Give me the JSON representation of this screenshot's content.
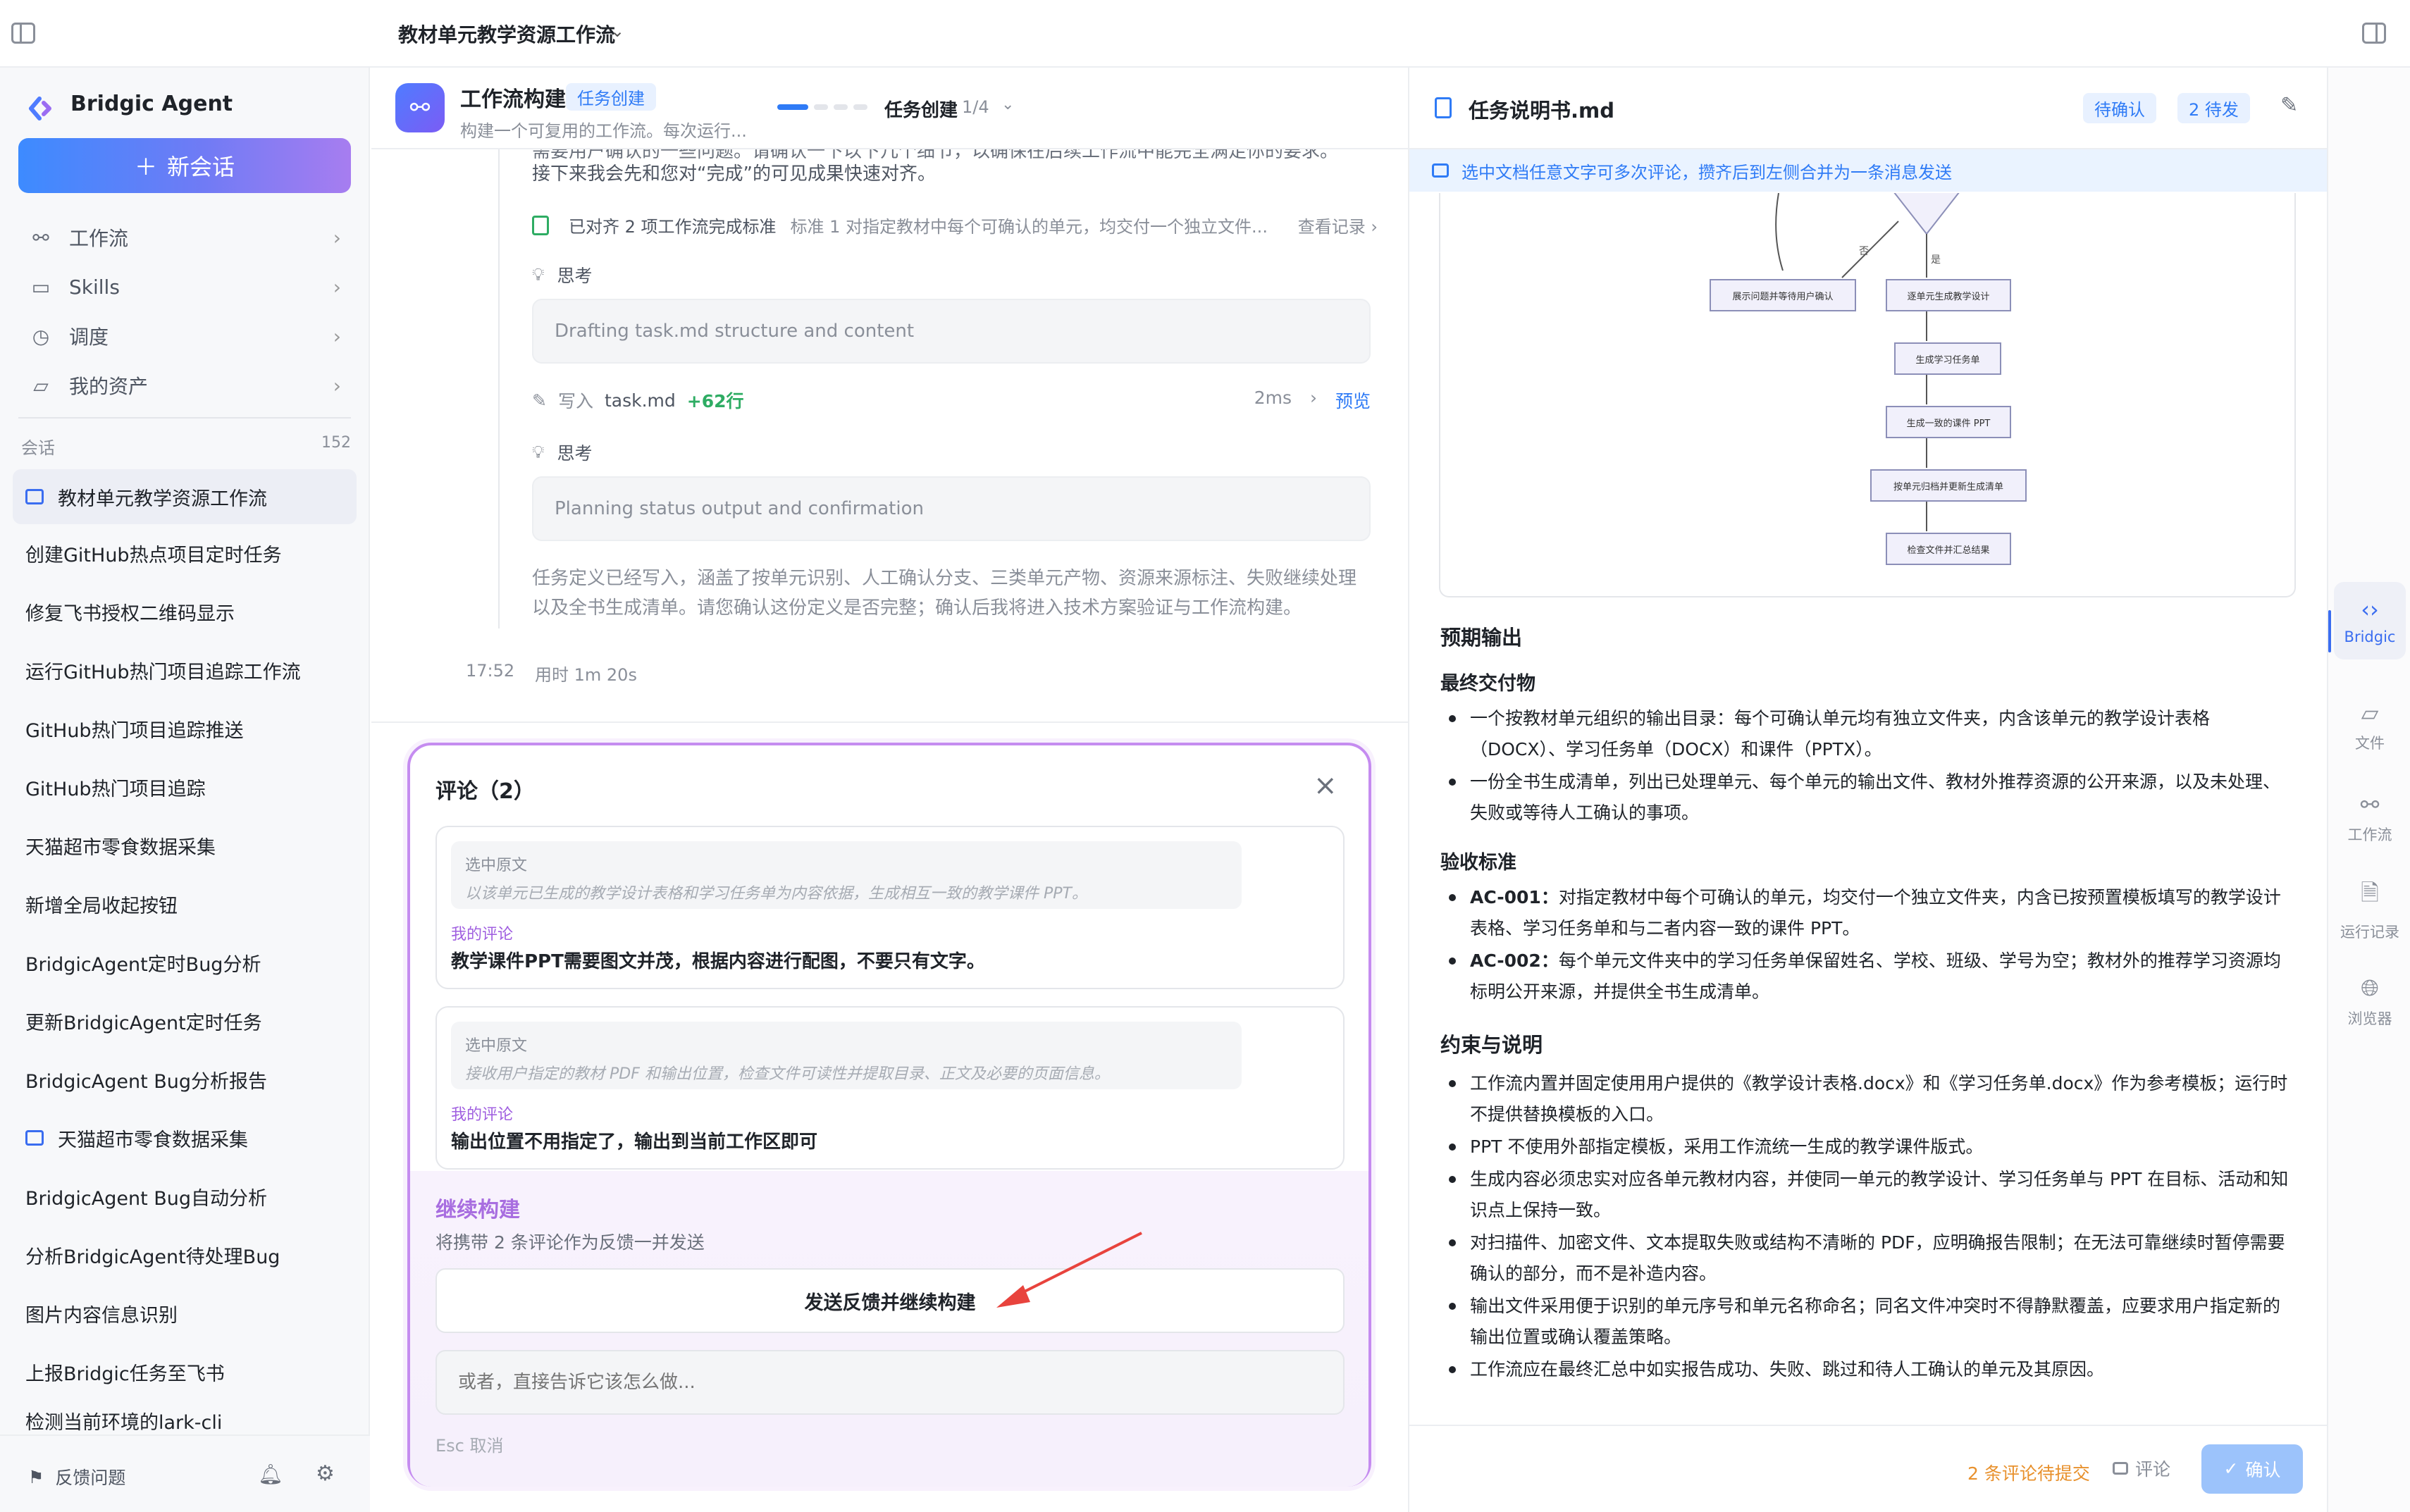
{
  "topbar": {
    "title": "教材单元教学资源工作流"
  },
  "sidebar": {
    "brand": "Bridgic Agent",
    "new_chat": "新会话",
    "nav": [
      {
        "label": "工作流",
        "icon": "workflow-icon"
      },
      {
        "label": "Skills",
        "icon": "terminal-icon"
      },
      {
        "label": "调度",
        "icon": "clock-icon"
      },
      {
        "label": "我的资产",
        "icon": "folder-icon"
      }
    ],
    "conversations_label": "会话",
    "conversations_count": "152",
    "conversations": [
      "教材单元教学资源工作流",
      "创建GitHub热点项目定时任务",
      "修复飞书授权二维码显示",
      "运行GitHub热门项目追踪工作流",
      "GitHub热门项目追踪推送",
      "GitHub热门项目追踪",
      "天猫超市零食数据采集",
      "新增全局收起按钮",
      "BridgicAgent定时Bug分析",
      "更新BridgicAgent定时任务",
      "BridgicAgent Bug分析报告",
      "天猫超市零食数据采集",
      "BridgicAgent Bug自动分析",
      "分析BridgicAgent待处理Bug",
      "图片内容信息识别",
      "上报Bridgic任务至飞书",
      "检测当前环境的lark-cli"
    ],
    "feedback": "反馈问题"
  },
  "chat": {
    "header": {
      "name": "工作流构建",
      "tag": "任务创建",
      "desc": "构建一个可复用的工作流。每次运行...",
      "stage": "任务创建",
      "stage_count": "1/4"
    },
    "intro_line1": "需要用户确认的一些问题。请确认一下以下几个细节，以确保在后续工作流中能完全满足你的要求。",
    "intro_line2": "接下来我会先和您对“完成”的可见成果快速对齐。",
    "check": {
      "title": "已对齐 2 项工作流完成标准",
      "detail": "标准 1 对指定教材中每个可确认的单元，均交付一个独立文件...",
      "link": "查看记录"
    },
    "think_label": "思考",
    "think1": "Drafting task.md structure and content",
    "write": {
      "action": "写入",
      "file": "task.md",
      "lines": "+62行",
      "time": "2ms",
      "preview": "预览"
    },
    "think2": "Planning status output and confirmation",
    "summary_line1": "任务定义已经写入，涵盖了按单元识别、人工确认分支、三类单元产物、资源来源标注、失败继续处理",
    "summary_line2": "以及全书生成清单。请您确认这份定义是否完整；确认后我将进入技术方案验证与工作流构建。",
    "time": "17:52",
    "duration": "用时 1m 20s"
  },
  "comments": {
    "title": "评论（2）",
    "items": [
      {
        "quote_label": "选中原文",
        "quote": "以该单元已生成的教学设计表格和学习任务单为内容依据，生成相互一致的教学课件 PPT。",
        "my_label": "我的评论",
        "text": "教学课件PPT需要图文并茂，根据内容进行配图，不要只有文字。"
      },
      {
        "quote_label": "选中原文",
        "quote": "接收用户指定的教材 PDF 和输出位置，检查文件可读性并提取目录、正文及必要的页面信息。",
        "my_label": "我的评论",
        "text": "输出位置不用指定了，输出到当前工作区即可"
      }
    ],
    "continue_title": "继续构建",
    "continue_sub": "将携带 2 条评论作为反馈一并发送",
    "send_button": "发送反馈并继续构建",
    "input_placeholder": "或者，直接告诉它该怎么做...",
    "esc_hint": "Esc 取消"
  },
  "doc": {
    "filename": "任务说明书.md",
    "badge_pending": "待确认",
    "badge_tosend": "2 待发",
    "tip": "选中文档任意文字可多次评论，攒齐后到左侧合并为一条消息发送",
    "flow": {
      "nodes": [
        "展示问题并等待用户确认",
        "逐单元生成教学设计",
        "生成学习任务单",
        "生成一致的课件 PPT",
        "按单元归档并更新生成清单",
        "检查文件并汇总结果"
      ],
      "label_no": "否",
      "label_yes": "是"
    },
    "h_output": "预期输出",
    "h_deliverable": "最终交付物",
    "deliverables": [
      "一个按教材单元组织的输出目录：每个可确认单元均有独立文件夹，内含该单元的教学设计表格（DOCX）、学习任务单（DOCX）和课件（PPTX）。",
      "一份全书生成清单，列出已处理单元、每个单元的输出文件、教材外推荐资源的公开来源，以及未处理、失败或等待人工确认的事项。"
    ],
    "h_acceptance": "验收标准",
    "acceptance": [
      {
        "id": "AC-001：",
        "text": "对指定教材中每个可确认的单元，均交付一个独立文件夹，内含已按预置模板填写的教学设计表格、学习任务单和与二者内容一致的课件 PPT。"
      },
      {
        "id": "AC-002：",
        "text": "每个单元文件夹中的学习任务单保留姓名、学校、班级、学号为空；教材外的推荐学习资源均标明公开来源，并提供全书生成清单。"
      }
    ],
    "h_constraints": "约束与说明",
    "constraints": [
      "工作流内置并固定使用用户提供的《教学设计表格.docx》和《学习任务单.docx》作为参考模板；运行时不提供替换模板的入口。",
      "PPT 不使用外部指定模板，采用工作流统一生成的教学课件版式。",
      "生成内容必须忠实对应各单元教材内容，并使同一单元的教学设计、学习任务单与 PPT 在目标、活动和知识点上保持一致。",
      "对扫描件、加密文件、文本提取失败或结构不清晰的 PDF，应明确报告限制；在无法可靠继续时暂停需要确认的部分，而不是补造内容。",
      "输出文件采用便于识别的单元序号和单元名称命名；同名文件冲突时不得静默覆盖，应要求用户指定新的输出位置或确认覆盖策略。",
      "工作流应在最终汇总中如实报告成功、失败、跳过和待人工确认的单元及其原因。"
    ],
    "footer": {
      "pending": "2 条评论待提交",
      "comment": "评论",
      "confirm": "确认"
    }
  },
  "rail": [
    {
      "label": "Bridgic",
      "icon": "bridgic-logo-icon"
    },
    {
      "label": "文件",
      "icon": "folder-icon"
    },
    {
      "label": "工作流",
      "icon": "workflow-icon"
    },
    {
      "label": "运行记录",
      "icon": "doc-check-icon"
    },
    {
      "label": "浏览器",
      "icon": "globe-icon"
    }
  ],
  "colors": {
    "accent": "#2f7bf6",
    "purple_border": "#c58cf0",
    "success": "#2eac63",
    "warning": "#e8912d"
  }
}
